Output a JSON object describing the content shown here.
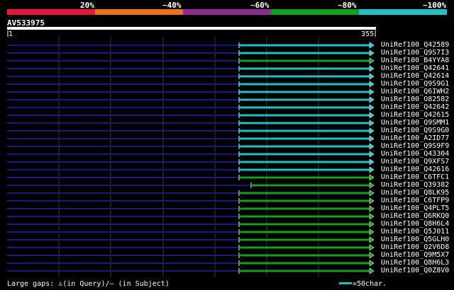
{
  "legend": [
    {
      "label": "20%",
      "color": "#e8183c"
    },
    {
      "label": "~40%",
      "color": "#e8751a"
    },
    {
      "label": "~60%",
      "color": "#8e2d91"
    },
    {
      "label": "~80%",
      "color": "#14a01e"
    },
    {
      "label": "~100%",
      "color": "#1fc1c8"
    }
  ],
  "query": {
    "id": "AV533975",
    "start": "1",
    "end": "355"
  },
  "hits": [
    {
      "name": "UniRef100_Q42589",
      "color": "cyan"
    },
    {
      "name": "UniRef100_Q9S7I3",
      "color": "cyan"
    },
    {
      "name": "UniRef100_B4YYA8",
      "color": "green"
    },
    {
      "name": "UniRef100_Q42641",
      "color": "cyan"
    },
    {
      "name": "UniRef100_Q42614",
      "color": "cyan"
    },
    {
      "name": "UniRef100_Q9S9G1",
      "color": "cyan"
    },
    {
      "name": "UniRef100_Q6IWH2",
      "color": "cyan"
    },
    {
      "name": "UniRef100_O82582",
      "color": "cyan"
    },
    {
      "name": "UniRef100_Q42642",
      "color": "cyan"
    },
    {
      "name": "UniRef100_Q42615",
      "color": "cyan"
    },
    {
      "name": "UniRef100_Q9SMM1",
      "color": "cyan"
    },
    {
      "name": "UniRef100_Q9S9G0",
      "color": "cyan"
    },
    {
      "name": "UniRef100_A2ID77",
      "color": "cyan"
    },
    {
      "name": "UniRef100_Q9S9F9",
      "color": "cyan"
    },
    {
      "name": "UniRef100_Q43304",
      "color": "cyan"
    },
    {
      "name": "UniRef100_Q9XFS7",
      "color": "cyan"
    },
    {
      "name": "UniRef100_Q42616",
      "color": "cyan"
    },
    {
      "name": "UniRef100_C6TFC1",
      "color": "green"
    },
    {
      "name": "UniRef100_Q39382",
      "color": "green",
      "short": true
    },
    {
      "name": "UniRef100_Q8LK95",
      "color": "green"
    },
    {
      "name": "UniRef100_C6TFP9",
      "color": "green"
    },
    {
      "name": "UniRef100_Q4PLT5",
      "color": "green"
    },
    {
      "name": "UniRef100_Q6RKQ0",
      "color": "green"
    },
    {
      "name": "UniRef100_Q8H6L4",
      "color": "green"
    },
    {
      "name": "UniRef100_Q5J011",
      "color": "green"
    },
    {
      "name": "UniRef100_Q5GLH0",
      "color": "green"
    },
    {
      "name": "UniRef100_Q2V6D8",
      "color": "green"
    },
    {
      "name": "UniRef100_Q9M5X7",
      "color": "green"
    },
    {
      "name": "UniRef100_Q8H6L3",
      "color": "green"
    },
    {
      "name": "UniRef100_Q0Z8V0",
      "color": "green"
    }
  ],
  "colors": {
    "cyan": "#1fc1c8",
    "green": "#14a01e",
    "gap": "#1a1a80",
    "grid": "#3a3a3a"
  },
  "footer": {
    "gaps_text": "Large gaps: ♙(in Query)/– (in Subject)",
    "scale_text": "=50char."
  }
}
